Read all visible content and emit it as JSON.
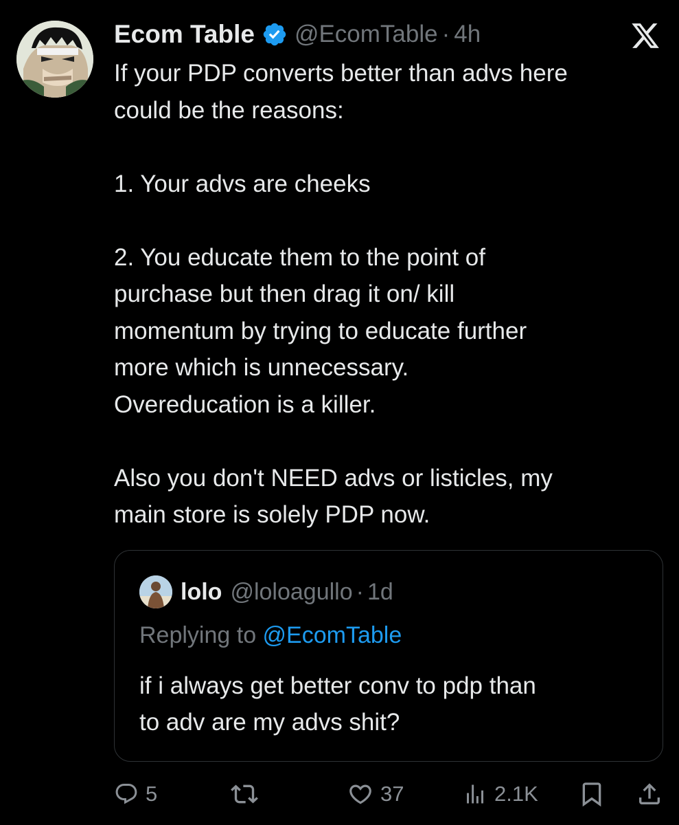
{
  "tweet": {
    "author": {
      "display_name": "Ecom Table",
      "handle": "@EcomTable",
      "verified": true
    },
    "separator": "·",
    "time": "4h",
    "text_lines": [
      "If your PDP converts better than advs here",
      "could be the reasons:",
      "",
      "1. Your advs are cheeks",
      "",
      "2. You educate them to the point of",
      "purchase but then drag it on/ kill",
      "momentum by trying to educate further",
      "more which is unnecessary.",
      "Overeducation is a killer.",
      "",
      "Also you don't NEED advs or listicles, my",
      "main store is solely PDP now."
    ]
  },
  "quoted": {
    "author": {
      "display_name": "lolo",
      "handle": "@loloagullo"
    },
    "separator": "·",
    "time": "1d",
    "replying_prefix": "Replying to ",
    "replying_to": "@EcomTable",
    "text_lines": [
      "if i always get better conv to pdp than",
      "to adv are my advs shit?"
    ]
  },
  "actions": {
    "replies": "5",
    "likes": "37",
    "views": "2.1K"
  },
  "icons": {
    "brand": "x-logo",
    "verified": "verified-badge-icon",
    "reply": "reply-icon",
    "retweet": "retweet-icon",
    "like": "heart-icon",
    "views": "views-icon",
    "bookmark": "bookmark-icon",
    "share": "share-icon"
  },
  "colors": {
    "background": "#000000",
    "text": "#e7e9ea",
    "muted": "#71767b",
    "accent": "#1d9bf0"
  }
}
